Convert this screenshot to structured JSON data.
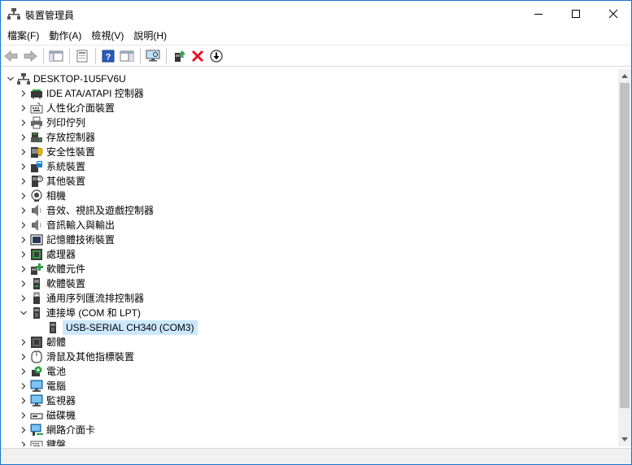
{
  "window": {
    "title": "裝置管理員",
    "minimize_label": "—",
    "maximize_label": "□",
    "close_label": "✕"
  },
  "menu": [
    {
      "label": "檔案(F)"
    },
    {
      "label": "動作(A)"
    },
    {
      "label": "檢視(V)"
    },
    {
      "label": "說明(H)"
    }
  ],
  "tree": {
    "root": "DESKTOP-1U5FV6U",
    "categories": [
      {
        "label": "IDE ATA/ATAPI 控制器",
        "icon": "ide-controller-icon"
      },
      {
        "label": "人性化介面裝置",
        "icon": "hid-icon"
      },
      {
        "label": "列印佇列",
        "icon": "printer-icon"
      },
      {
        "label": "存放控制器",
        "icon": "storage-controller-icon"
      },
      {
        "label": "安全性裝置",
        "icon": "security-device-icon"
      },
      {
        "label": "系統裝置",
        "icon": "system-device-icon"
      },
      {
        "label": "其他裝置",
        "icon": "other-device-icon"
      },
      {
        "label": "相機",
        "icon": "camera-icon"
      },
      {
        "label": "音效、視訊及遊戲控制器",
        "icon": "sound-icon"
      },
      {
        "label": "音訊輸入與輸出",
        "icon": "audio-io-icon"
      },
      {
        "label": "記憶體技術裝置",
        "icon": "memory-tech-icon"
      },
      {
        "label": "處理器",
        "icon": "processor-icon"
      },
      {
        "label": "軟體元件",
        "icon": "software-component-icon"
      },
      {
        "label": "軟體裝置",
        "icon": "software-device-icon"
      },
      {
        "label": "通用序列匯流排控制器",
        "icon": "usb-controller-icon"
      },
      {
        "label": "連接埠 (COM 和 LPT)",
        "icon": "port-icon",
        "expanded": true
      },
      {
        "label": "韌體",
        "icon": "firmware-icon"
      },
      {
        "label": "滑鼠及其他指標裝置",
        "icon": "mouse-icon"
      },
      {
        "label": "電池",
        "icon": "battery-icon"
      },
      {
        "label": "電腦",
        "icon": "computer-icon"
      },
      {
        "label": "監視器",
        "icon": "monitor-icon"
      },
      {
        "label": "磁碟機",
        "icon": "disk-drive-icon"
      },
      {
        "label": "網路介面卡",
        "icon": "network-adapter-icon"
      },
      {
        "label": "鍵盤",
        "icon": "keyboard-icon"
      }
    ],
    "port_child": "USB-SERIAL CH340 (COM3)"
  },
  "colors": {
    "selection": "#cce8ff",
    "window_border": "#1a73c9",
    "remove_red": "#e81123"
  }
}
